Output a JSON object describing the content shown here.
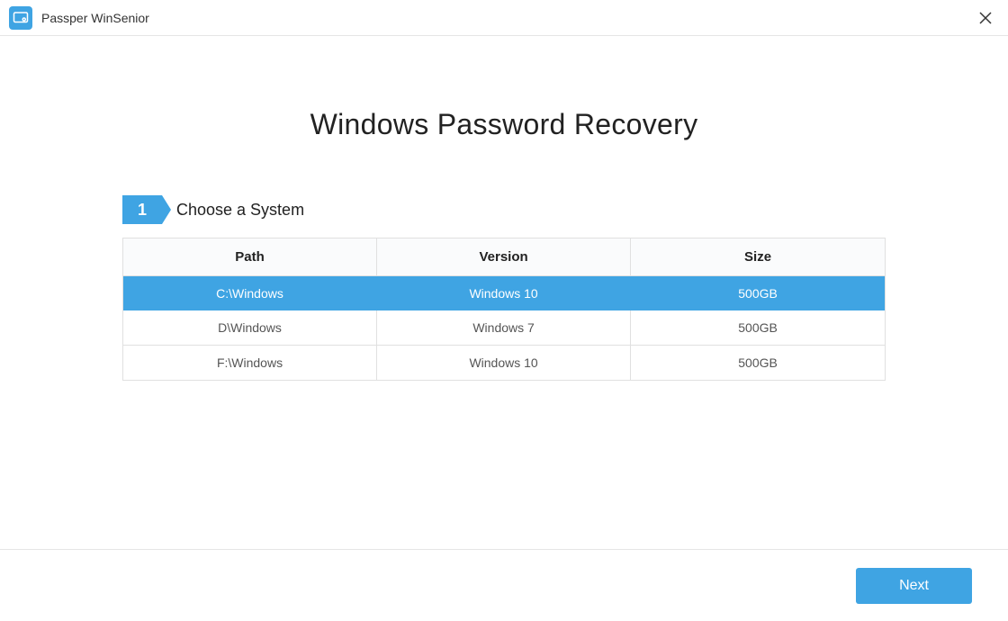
{
  "titlebar": {
    "app_name": "Passper WinSenior"
  },
  "page": {
    "title": "Windows Password Recovery"
  },
  "step": {
    "number": "1",
    "label": "Choose a System"
  },
  "table": {
    "headers": {
      "path": "Path",
      "version": "Version",
      "size": "Size"
    },
    "rows": [
      {
        "path": "C:\\Windows",
        "version": "Windows 10",
        "size": "500GB",
        "selected": true
      },
      {
        "path": "D\\Windows",
        "version": "Windows 7",
        "size": "500GB",
        "selected": false
      },
      {
        "path": "F:\\Windows",
        "version": "Windows 10",
        "size": "500GB",
        "selected": false
      }
    ]
  },
  "footer": {
    "next_label": "Next"
  },
  "colors": {
    "accent": "#3fa4e3"
  }
}
